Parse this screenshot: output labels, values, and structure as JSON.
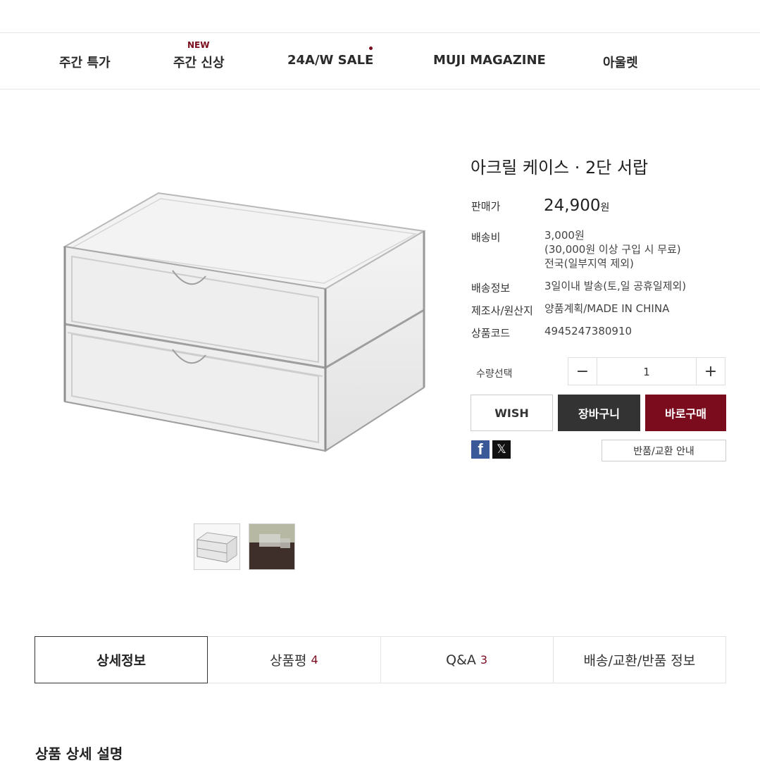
{
  "nav": {
    "items": [
      {
        "label": "주간 특가"
      },
      {
        "label": "주간 신상",
        "badge": "NEW"
      },
      {
        "label": "24A/W SALE"
      },
      {
        "label": "MUJI MAGAZINE"
      },
      {
        "label": "아울렛"
      }
    ]
  },
  "product": {
    "title": "아크릴 케이스 · 2단 서랍",
    "price_label": "판매가",
    "price": "24,900",
    "price_unit": "원",
    "shipping_fee_label": "배송비",
    "shipping_fee": "3,000원",
    "shipping_fee_note": "(30,000원 이상 구입 시 무료)",
    "shipping_fee_region": "전국(일부지역 제외)",
    "delivery_label": "배송정보",
    "delivery": "3일이내 발송(토,일 공휴일제외)",
    "maker_label": "제조사/원산지",
    "maker": "양품계획/MADE IN CHINA",
    "code_label": "상품코드",
    "code": "4945247380910"
  },
  "quantity": {
    "label": "수량선택",
    "value": "1"
  },
  "buttons": {
    "wish": "WISH",
    "cart": "장바구니",
    "buy": "바로구매",
    "return_info": "반품/교환 안내"
  },
  "share": {
    "icons": [
      "facebook-icon",
      "x-icon"
    ]
  },
  "tabs": [
    {
      "label": "상세정보",
      "count": ""
    },
    {
      "label": "상품평",
      "count": "4"
    },
    {
      "label": "Q&A",
      "count": "3"
    },
    {
      "label": "배송/교환/반품 정보",
      "count": ""
    }
  ],
  "section": {
    "title": "상품 상세 설명"
  },
  "colors": {
    "accent": "#7b0c1e",
    "dark_button": "#333333"
  }
}
